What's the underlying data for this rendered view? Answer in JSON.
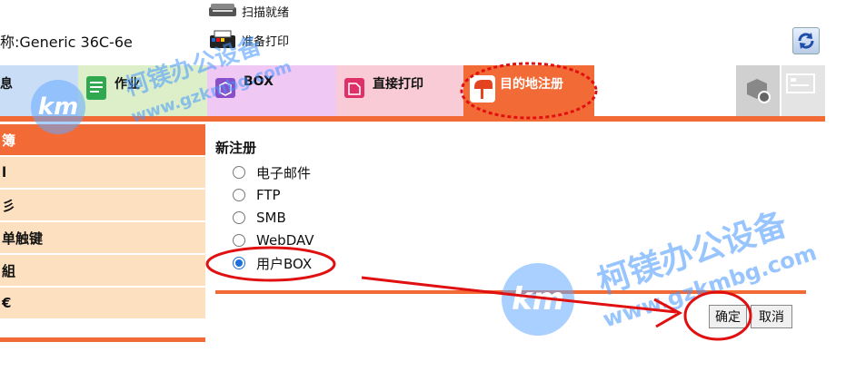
{
  "header": {
    "device_name": "称:Generic 36C-6e",
    "status_scan": "扫描就绪",
    "status_print": "准备打印"
  },
  "tabs": [
    {
      "label": "息"
    },
    {
      "label": "作业"
    },
    {
      "label": "BOX"
    },
    {
      "label": "直接打印"
    },
    {
      "label": "目的地注册"
    }
  ],
  "sidebar": {
    "items": [
      "簿",
      "l",
      "彡",
      "单触键",
      "組",
      "€"
    ]
  },
  "form": {
    "title": "新注册",
    "options": [
      "电子邮件",
      "FTP",
      "SMB",
      "WebDAV",
      "用户BOX"
    ],
    "selected_index": 4,
    "ok_label": "确定",
    "cancel_label": "取消"
  },
  "watermark": {
    "name": "柯镁办公设备",
    "url": "www.gzkmbg.com",
    "logo": "km"
  },
  "colors": {
    "accent": "#f26a35",
    "sidebar_bg": "#fde0bf",
    "annotation": "#e01010"
  }
}
